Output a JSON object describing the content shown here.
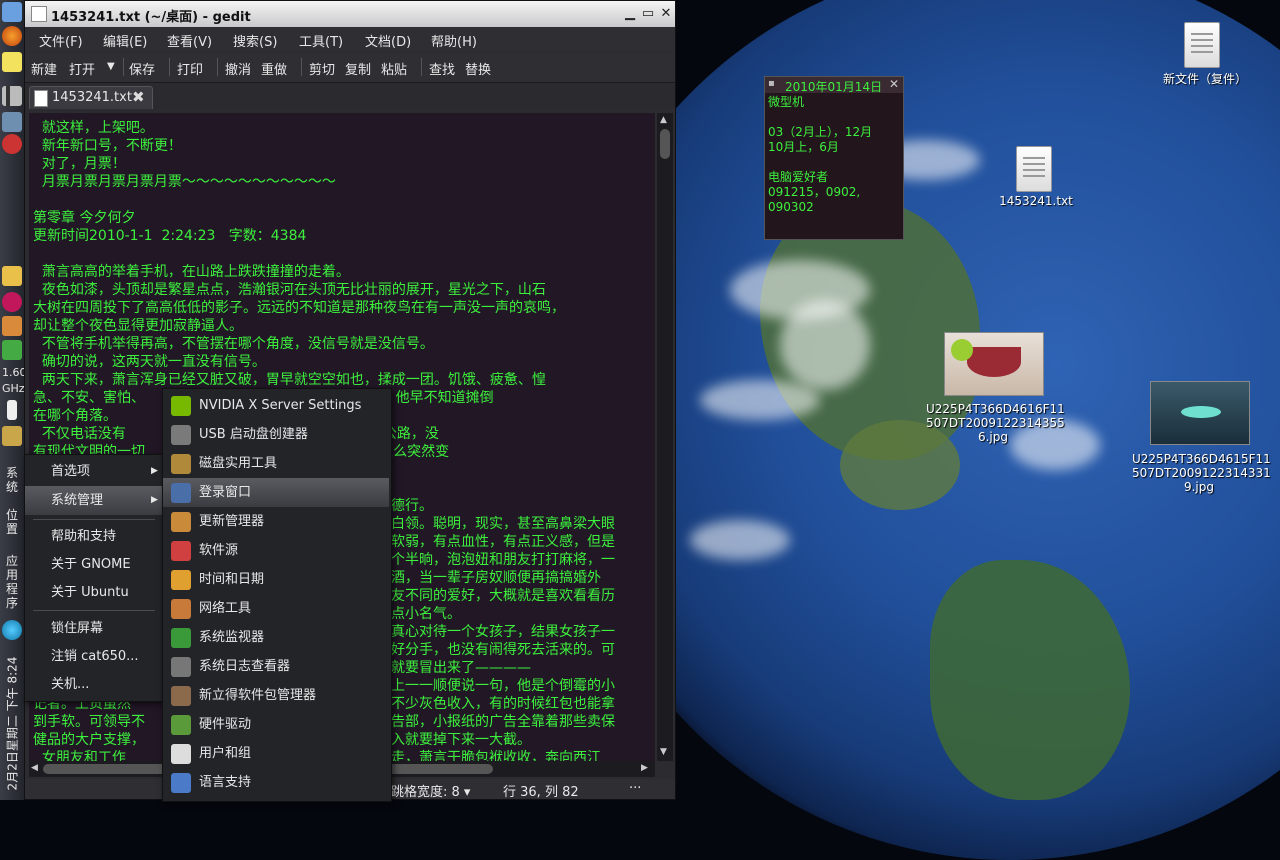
{
  "panel": {
    "cpu_label": "1.60",
    "cpu_unit": "GHz",
    "menu_labels": [
      "系统",
      "位置",
      "应用程序"
    ],
    "clock": "2月2日星期二 下午 8:24"
  },
  "window": {
    "title": "1453241.txt (~/桌面) - gedit",
    "menu": [
      "文件(F)",
      "编辑(E)",
      "查看(V)",
      "搜索(S)",
      "工具(T)",
      "文档(D)",
      "帮助(H)"
    ],
    "toolbar": [
      "新建",
      "打开",
      "保存",
      "打印",
      "撤消",
      "重做",
      "剪切",
      "复制",
      "粘贴",
      "查找",
      "替换"
    ],
    "tab_label": "1453241.txt",
    "editor_lines": [
      "  就这样，上架吧。",
      "  新年新口号，不断更！",
      "  对了，月票！",
      "  月票月票月票月票月票～～～～～～～～～～～",
      "",
      "第零章 今夕何夕",
      "更新时间2010-1-1  2:24:23   字数：4384",
      "",
      "  萧言高高的举着手机，在山路上跌跌撞撞的走着。",
      "  夜色如漆，头顶却是繁星点点，浩瀚银河在头顶无比壮丽的展开，星光之下，山石",
      "大树在四周投下了高高低低的影子。远远的不知道是那种夜鸟在有一声没一声的哀鸣，",
      "却让整个夜色显得更加寂静逼人。",
      "  不管将手机举得再高，不管摆在哪个角度，没信号就是没信号。",
      "  确切的说，这两天就一直没有信号。",
      "  两天下来，萧言浑身已经又脏又破，胃早就空空如也，揉成一团。饥饿、疲惫、惶",
      "急、不安、害怕、                            的欲望支撑着萧言，他早不知道摊倒",
      "在哪个角落。",
      "  不仅电话没有                    没有远处城市的灯火，没有公路，没",
      "有现代文明的一切                  啊——自己熟悉的世界，怎么突然变"
    ],
    "editor_right_lines": [
      "德行。",
      "白领。聪明，现实，甚至高鼻梁大眼",
      "软弱，有点血性，有点正义感，但是",
      "个半晌，泡泡妞和朋友打打麻将，一",
      "酒，当一辈子房奴顺便再搞搞婚外",
      "友不同的爱好，大概就是喜欢看看历",
      "点小名气。",
      "真心对待一个女孩子，结果女孩子一",
      "好分手，也没有闹得死去活来的。可",
      "就要冒出来了————",
      "上一一顺便说一句，他是个倒霉的小",
      "不少灰色收入，有的时候红包也能拿",
      "告部，小报纸的广告全靠着那些卖保",
      "入就要掉下来一大截。",
      "走，萧言干脆包袱收收，奔向西江"
    ],
    "editor_left_lines": [
      "记者。上贡虽然",
      "到手软。可领导不",
      "健品的大户支撑，",
      "  女朋友和工作"
    ],
    "status": {
      "tab_width": "跳格宽度: 8",
      "position": "行 36, 列 82",
      "extra": "···"
    }
  },
  "system_menu": {
    "items": [
      "首选项",
      "系统管理",
      "帮助和支持",
      "关于 GNOME",
      "关于 Ubuntu",
      "锁住屏幕",
      "注销 cat650...",
      "关机..."
    ],
    "selected": "系统管理"
  },
  "admin_submenu": {
    "items": [
      "NVIDIA X Server Settings",
      "USB 启动盘创建器",
      "磁盘实用工具",
      "登录窗口",
      "更新管理器",
      "软件源",
      "时间和日期",
      "网络工具",
      "系统监视器",
      "系统日志查看器",
      "新立得软件包管理器",
      "硬件驱动",
      "用户和组",
      "语言支持"
    ],
    "selected": "登录窗口"
  },
  "note": {
    "title": "2010年01月14日",
    "lines": [
      "微型机",
      "",
      "03（2月上），12月",
      "10月上，6月",
      "",
      "电脑爱好者",
      "091215，0902,",
      "090302"
    ]
  },
  "desktop_icons": [
    {
      "label": "新文件（复件）"
    },
    {
      "label": "1453241.txt"
    },
    {
      "label": "U225P4T366D4616F11 507DT2009122314355 6.jpg"
    },
    {
      "label": "U225P4T366D4615F11 507DT2009122314331 9.jpg"
    }
  ]
}
